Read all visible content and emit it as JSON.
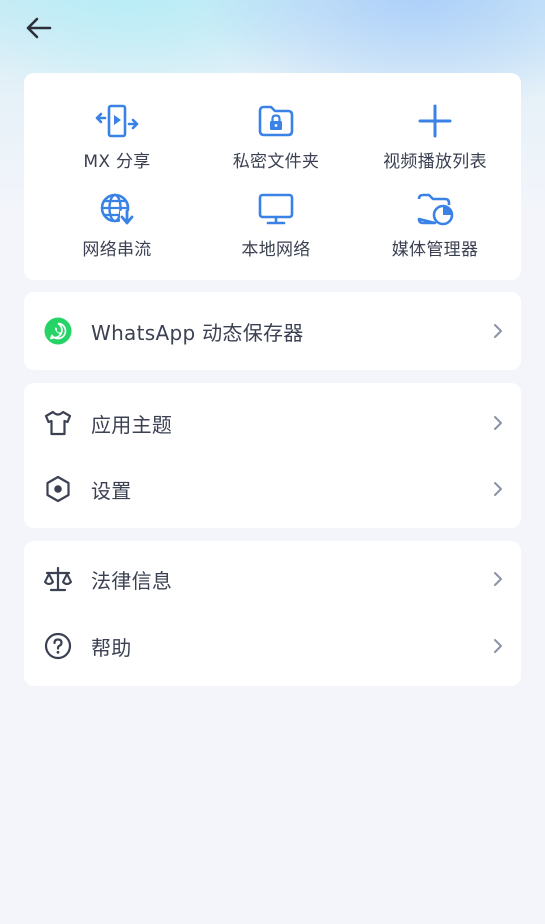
{
  "colors": {
    "accent": "#3b82e6",
    "text": "#3b4152",
    "chevron": "#8a93a6",
    "whatsapp": "#25d366",
    "background": "#f3f5fa"
  },
  "header": {
    "back_icon": "arrow-left-icon"
  },
  "tools": [
    {
      "label": "MX 分享",
      "icon": "mx-share-icon"
    },
    {
      "label": "私密文件夹",
      "icon": "private-folder-icon"
    },
    {
      "label": "视频播放列表",
      "icon": "plus-icon"
    },
    {
      "label": "网络串流",
      "icon": "network-stream-icon"
    },
    {
      "label": "本地网络",
      "icon": "monitor-icon"
    },
    {
      "label": "媒体管理器",
      "icon": "media-manager-icon"
    }
  ],
  "whatsapp": {
    "label": "WhatsApp 动态保存器",
    "icon": "whatsapp-icon"
  },
  "group1": [
    {
      "label": "应用主题",
      "icon": "tshirt-icon"
    },
    {
      "label": "设置",
      "icon": "settings-hex-icon"
    }
  ],
  "group2": [
    {
      "label": "法律信息",
      "icon": "scales-icon"
    },
    {
      "label": "帮助",
      "icon": "help-icon"
    }
  ]
}
